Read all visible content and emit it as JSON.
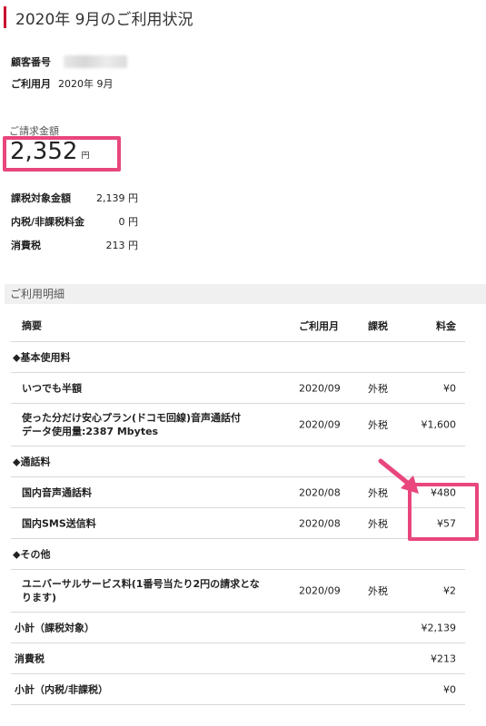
{
  "page": {
    "title": "2020年 9月のご利用状況"
  },
  "customer": {
    "number_label": "顧客番号",
    "month_label": "ご利用月",
    "month_value": "2020年 9月"
  },
  "billing": {
    "label": "ご請求金額",
    "amount": "2,352",
    "unit": "円"
  },
  "tax_summary": [
    {
      "label": "課税対象金額",
      "value": "2,139 円"
    },
    {
      "label": "内税/非課税料金",
      "value": "0 円"
    },
    {
      "label": "消費税",
      "value": "213 円"
    }
  ],
  "details": {
    "title": "ご利用明細",
    "headers": {
      "desc": "摘要",
      "month": "ご利用月",
      "tax": "課税",
      "fee": "料金"
    },
    "rows": [
      {
        "kind": "cat",
        "desc": "◆基本使用料"
      },
      {
        "kind": "item",
        "desc": "いつでも半額",
        "month": "2020/09",
        "tax": "外税",
        "fee": "¥0"
      },
      {
        "kind": "item2",
        "desc": "使った分だけ安心プラン(ドコモ回線)音声通話付",
        "desc2": "データ使用量:2387 Mbytes",
        "month": "2020/09",
        "tax": "外税",
        "fee": "¥1,600"
      },
      {
        "kind": "cat",
        "desc": "◆通話料"
      },
      {
        "kind": "item",
        "desc": "国内音声通話料",
        "month": "2020/08",
        "tax": "外税",
        "fee": "¥480"
      },
      {
        "kind": "item",
        "desc": "国内SMS送信料",
        "month": "2020/08",
        "tax": "外税",
        "fee": "¥57"
      },
      {
        "kind": "cat",
        "desc": "◆その他"
      },
      {
        "kind": "item2",
        "desc": "ユニバーサルサービス料(1番号当たり2円の請求とな",
        "desc2": "ります)",
        "month": "2020/09",
        "tax": "外税",
        "fee": "¥2"
      },
      {
        "kind": "sum",
        "desc": "小計（課税対象）",
        "fee": "¥2,139"
      },
      {
        "kind": "sum",
        "desc": "消費税",
        "fee": "¥213"
      },
      {
        "kind": "sum",
        "desc": "小計（内税/非課税）",
        "fee": "¥0"
      }
    ]
  },
  "colors": {
    "accent": "#c8102e",
    "highlight": "#e8467c"
  }
}
